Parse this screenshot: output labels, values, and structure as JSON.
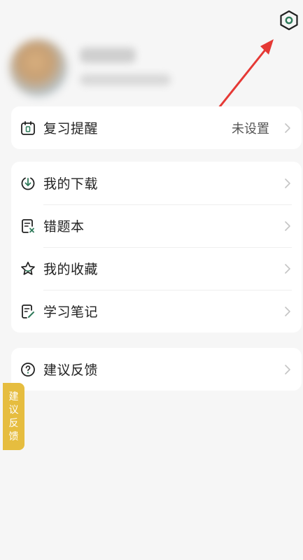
{
  "colors": {
    "background": "#f6f6f6",
    "card": "#ffffff",
    "accent_green": "#2f7a5a",
    "arrow_red": "#e53935",
    "feedback_tab": "#e6bd3f"
  },
  "header": {
    "settings_icon": "hexagon-settings-icon"
  },
  "profile": {
    "avatar_icon": "avatar",
    "name_blurred": true
  },
  "reminder_card": {
    "label": "复习提醒",
    "value": "未设置",
    "icon": "calendar-icon"
  },
  "menu_card": {
    "items": [
      {
        "label": "我的下载",
        "icon": "download-icon"
      },
      {
        "label": "错题本",
        "icon": "wrong-notebook-icon"
      },
      {
        "label": "我的收藏",
        "icon": "star-icon"
      },
      {
        "label": "学习笔记",
        "icon": "notes-icon"
      }
    ]
  },
  "feedback_card": {
    "label": "建议反馈",
    "icon": "question-icon"
  },
  "feedback_tab": {
    "chars": [
      "建",
      "议",
      "反",
      "馈"
    ]
  }
}
